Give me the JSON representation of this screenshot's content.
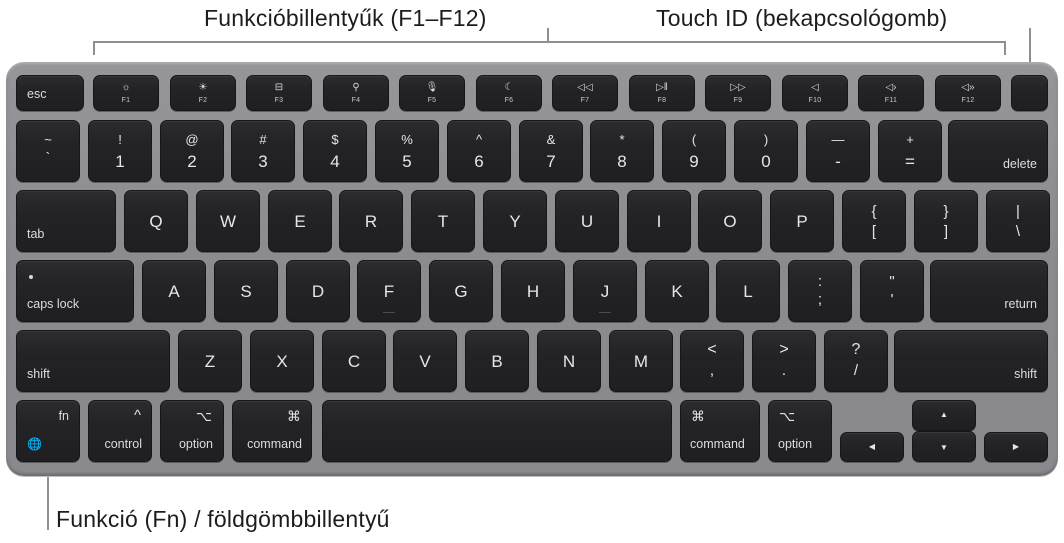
{
  "callouts": {
    "function_keys": "Funkcióbillentyűk (F1–F12)",
    "touch_id": "Touch ID (bekapcsológomb)",
    "fn_globe": "Funkció (Fn) / földgömbbillentyű"
  },
  "colors": {
    "key_face": "#232327",
    "key_text": "#e6e6ea",
    "keyboard_body": "#8e8e92",
    "callout_line": "#8e8e93",
    "callout_text": "#1d1d1f"
  },
  "row_fn": {
    "esc": "esc",
    "fkeys": [
      {
        "label": "F1",
        "icon": "☼",
        "icon_name": "brightness-down-icon"
      },
      {
        "label": "F2",
        "icon": "☀",
        "icon_name": "brightness-up-icon"
      },
      {
        "label": "F3",
        "icon": "⊟",
        "icon_name": "mission-control-icon"
      },
      {
        "label": "F4",
        "icon": "⚲",
        "icon_name": "spotlight-search-icon"
      },
      {
        "label": "F5",
        "icon": "🎙",
        "icon_name": "dictation-microphone-icon"
      },
      {
        "label": "F6",
        "icon": "☾",
        "icon_name": "do-not-disturb-moon-icon"
      },
      {
        "label": "F7",
        "icon": "◁◁",
        "icon_name": "rewind-icon"
      },
      {
        "label": "F8",
        "icon": "▷‖",
        "icon_name": "play-pause-icon"
      },
      {
        "label": "F9",
        "icon": "▷▷",
        "icon_name": "fast-forward-icon"
      },
      {
        "label": "F10",
        "icon": "◁",
        "icon_name": "mute-icon"
      },
      {
        "label": "F11",
        "icon": "◁›",
        "icon_name": "volume-down-icon"
      },
      {
        "label": "F12",
        "icon": "◁»",
        "icon_name": "volume-up-icon"
      }
    ]
  },
  "row_num": {
    "keys": [
      {
        "top": "~",
        "bot": "`"
      },
      {
        "top": "!",
        "bot": "1"
      },
      {
        "top": "@",
        "bot": "2"
      },
      {
        "top": "#",
        "bot": "3"
      },
      {
        "top": "$",
        "bot": "4"
      },
      {
        "top": "%",
        "bot": "5"
      },
      {
        "top": "^",
        "bot": "6"
      },
      {
        "top": "&",
        "bot": "7"
      },
      {
        "top": "*",
        "bot": "8"
      },
      {
        "top": "(",
        "bot": "9"
      },
      {
        "top": ")",
        "bot": "0"
      },
      {
        "top": "—",
        "bot": "-"
      },
      {
        "top": "+",
        "bot": "="
      }
    ],
    "delete": "delete"
  },
  "row_q": {
    "tab": "tab",
    "letters": [
      "Q",
      "W",
      "E",
      "R",
      "T",
      "Y",
      "U",
      "I",
      "O",
      "P"
    ],
    "brackets": [
      {
        "top": "{",
        "bot": "["
      },
      {
        "top": "}",
        "bot": "]"
      },
      {
        "top": "|",
        "bot": "\\"
      }
    ]
  },
  "row_a": {
    "caps": "caps lock",
    "letters": [
      "A",
      "S",
      "D",
      "F",
      "G",
      "H",
      "J",
      "K",
      "L"
    ],
    "punct": [
      {
        "top": ":",
        "bot": ";"
      },
      {
        "top": "\"",
        "bot": "'"
      }
    ],
    "return": "return"
  },
  "row_z": {
    "shift_left": "shift",
    "letters": [
      "Z",
      "X",
      "C",
      "V",
      "B",
      "N",
      "M"
    ],
    "punct": [
      {
        "top": "<",
        "bot": ","
      },
      {
        "top": ">",
        "bot": "."
      },
      {
        "top": "?",
        "bot": "/"
      }
    ],
    "shift_right": "shift"
  },
  "row_bottom": {
    "fn": "fn",
    "globe": "🌐",
    "control": "control",
    "control_sym": "^",
    "option": "option",
    "option_sym": "⌥",
    "command": "command",
    "command_sym": "⌘",
    "arrows": {
      "up": "▲",
      "down": "▼",
      "left": "◀",
      "right": "▶"
    }
  }
}
